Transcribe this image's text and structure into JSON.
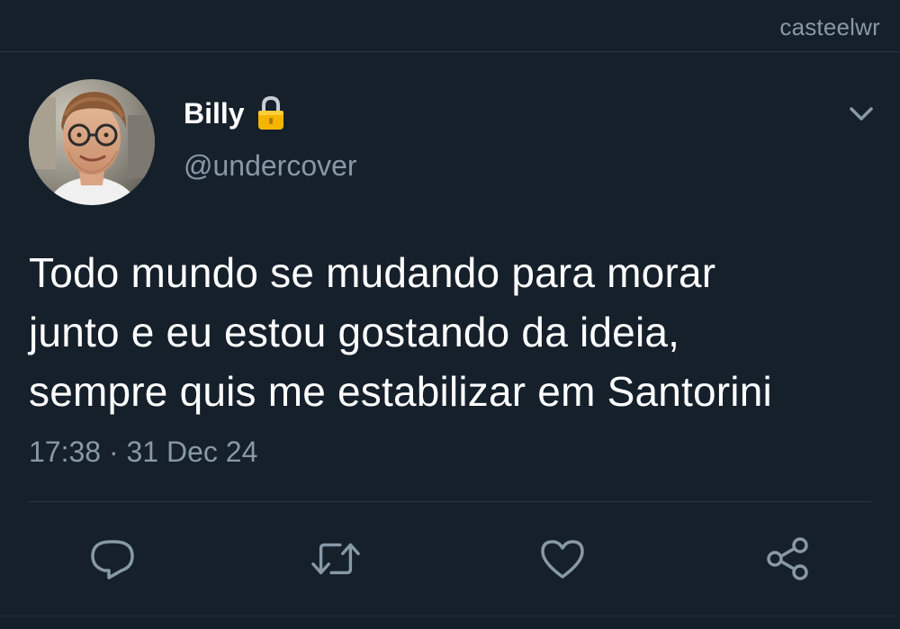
{
  "watermark": "casteelwr",
  "tweet": {
    "author_name": "Billy",
    "handle": "@undercover",
    "protected_icon": "lock-icon",
    "text_lines": [
      "Todo mundo se mudando para morar",
      "junto e eu estou gostando da ideia,",
      "sempre quis me estabilizar em Santorini"
    ],
    "timestamp": "17:38 · 31 Dec 24"
  },
  "actions": {
    "reply_icon": "reply-icon",
    "retweet_icon": "retweet-icon",
    "like_icon": "heart-icon",
    "share_icon": "share-icon"
  },
  "colors": {
    "background": "#15202b",
    "secondary_text": "#8899a6",
    "divider": "#2c3743",
    "primary_text": "#ffffff"
  }
}
